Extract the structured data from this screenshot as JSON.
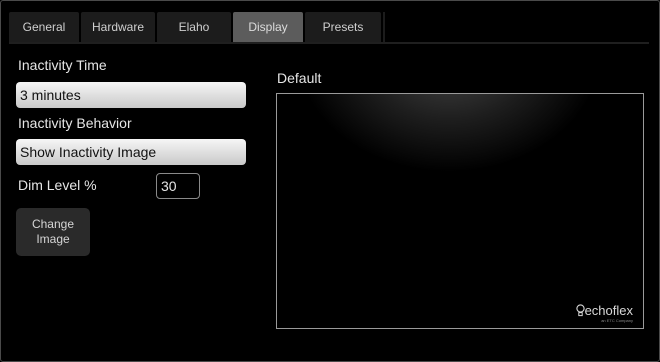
{
  "tabs": [
    {
      "label": "General",
      "active": false
    },
    {
      "label": "Hardware",
      "active": false
    },
    {
      "label": "Elaho",
      "active": false
    },
    {
      "label": "Display",
      "active": true
    },
    {
      "label": "Presets",
      "active": false
    }
  ],
  "settings": {
    "inactivity_time_label": "Inactivity Time",
    "inactivity_time_value": "3 minutes",
    "inactivity_behavior_label": "Inactivity Behavior",
    "inactivity_behavior_value": "Show Inactivity Image",
    "dim_level_label": "Dim Level %",
    "dim_level_value": "30",
    "change_image_line1": "Change",
    "change_image_line2": "Image"
  },
  "preview": {
    "label": "Default",
    "logo_text": "echoflex",
    "logo_subtext": "an ETC Company",
    "logo_icon": "lightbulb-icon"
  },
  "colors": {
    "active_tab": "#5c5c5c",
    "inactive_tab": "#1c1c1c",
    "background": "#000000",
    "dropdown_light": "#f6f6f6"
  }
}
